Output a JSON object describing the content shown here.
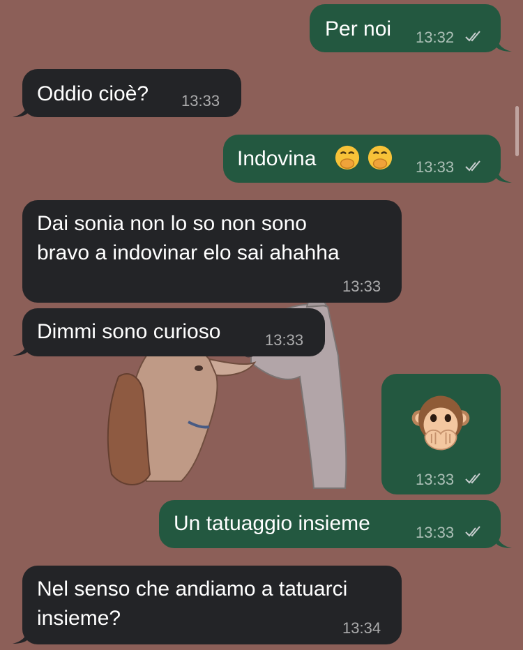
{
  "messages": [
    {
      "type": "outgoing",
      "text": "Per noi",
      "time": "13:32",
      "status": "read"
    },
    {
      "type": "incoming",
      "text": "Oddio cioè?",
      "time": "13:33"
    },
    {
      "type": "outgoing",
      "text": "Indovina",
      "emoji": [
        "hand-over-mouth-emoji",
        "hand-over-mouth-emoji"
      ],
      "time": "13:33",
      "status": "read"
    },
    {
      "type": "incoming",
      "text": "Dai sonia non lo so non sono\nbravo a indovinar elo sai ahahha",
      "time": "13:33"
    },
    {
      "type": "incoming",
      "text": "Dimmi sono curioso",
      "time": "13:33"
    },
    {
      "type": "outgoing",
      "emoji": [
        "speak-no-evil-monkey-emoji"
      ],
      "time": "13:33",
      "status": "read"
    },
    {
      "type": "outgoing",
      "text": "Un tatuaggio insieme",
      "time": "13:33",
      "status": "read"
    },
    {
      "type": "incoming",
      "text": "Nel senso che andiamo a tatuarci\ninsieme?",
      "time": "13:34"
    }
  ],
  "colors": {
    "background": "#8c5f58",
    "incoming_bubble": "#232427",
    "outgoing_bubble": "#235840",
    "text": "#ffffff",
    "meta_text": "#a9a9a9"
  }
}
